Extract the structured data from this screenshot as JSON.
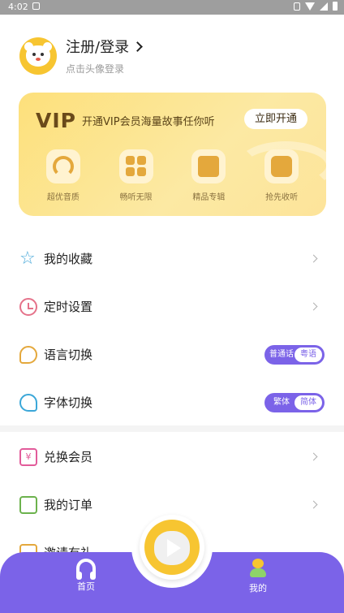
{
  "status_bar": {
    "time": "4:02"
  },
  "profile": {
    "title": "注册/登录",
    "subtitle": "点击头像登录"
  },
  "vip": {
    "logo": "VIP",
    "description": "开通VIP会员海量故事任你听",
    "button": "立即开通",
    "benefits": [
      {
        "label": "超优音质",
        "icon": "headphone-icon"
      },
      {
        "label": "畅听无限",
        "icon": "grid-icon"
      },
      {
        "label": "精品专辑",
        "icon": "book-icon"
      },
      {
        "label": "抢先收听",
        "icon": "tv-icon"
      }
    ]
  },
  "menu": {
    "favorites": "我的收藏",
    "timer": "定时设置",
    "language": {
      "label": "语言切换",
      "option_a": "普通话",
      "option_b": "粤语"
    },
    "font": {
      "label": "字体切换",
      "option_a": "繁体",
      "option_b": "简体"
    },
    "redeem": "兑换会员",
    "orders": "我的订单",
    "invite": "邀请有礼",
    "redeem_icon_text": "¥"
  },
  "bottom_nav": {
    "home": "首页",
    "mine": "我的"
  },
  "colors": {
    "accent": "#7b63e8",
    "vip_gold": "#fde07b",
    "avatar_yellow": "#f7c531"
  }
}
